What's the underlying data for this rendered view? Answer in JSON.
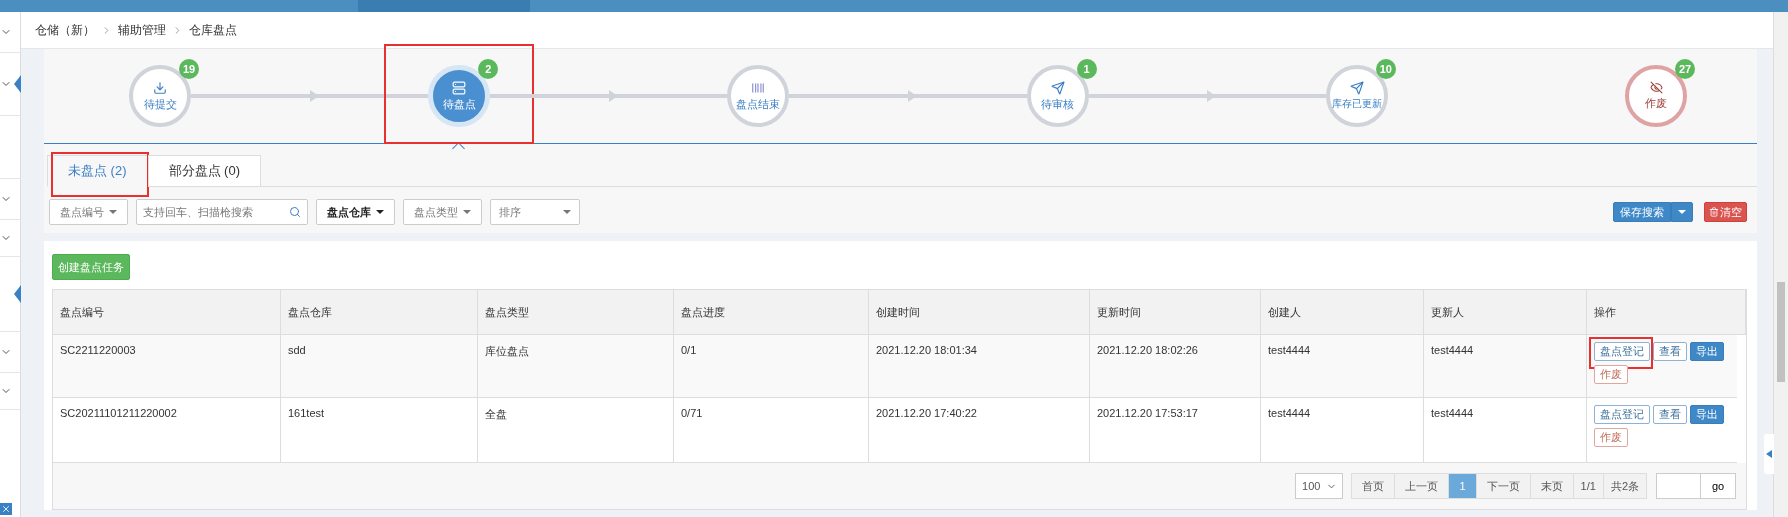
{
  "breadcrumb": [
    "仓储（新）",
    "辅助管理",
    "仓库盘点"
  ],
  "steps": [
    {
      "kind": "submit",
      "label": "待提交",
      "count": "19",
      "selected": false,
      "highlighted": false
    },
    {
      "kind": "counting",
      "label": "待盘点",
      "count": "2",
      "selected": true,
      "highlighted": true
    },
    {
      "kind": "finished",
      "label": "盘点结束",
      "selected": false,
      "highlighted": false
    },
    {
      "kind": "review",
      "label": "待审核",
      "count": "1",
      "selected": false,
      "highlighted": false
    },
    {
      "kind": "updated",
      "label": "库存已更新",
      "count": "10",
      "selected": false,
      "highlighted": false
    },
    {
      "kind": "void",
      "label": "作废",
      "count": "27",
      "selected": false,
      "highlighted": false
    }
  ],
  "tabs": [
    {
      "label": "未盘点 (2)",
      "selected": true,
      "highlighted": true
    },
    {
      "label": "部分盘点 (0)",
      "selected": false,
      "highlighted": false
    }
  ],
  "filters": [
    {
      "kind": "dropdown",
      "label": "盘点编号",
      "active": false
    },
    {
      "kind": "search",
      "placeholder": "支持回车、扫描枪搜索"
    },
    {
      "kind": "dropdown",
      "label": "盘点仓库",
      "active": true
    },
    {
      "kind": "dropdown",
      "label": "盘点类型",
      "active": false
    },
    {
      "kind": "select",
      "label": "排序"
    }
  ],
  "save_search": "保存搜索",
  "clear": "清空",
  "create_button": "创建盘点任务",
  "table": {
    "columns": [
      "盘点编号",
      "盘点仓库",
      "盘点类型",
      "盘点进度",
      "创建时间",
      "更新时间",
      "创建人",
      "更新人",
      "操作"
    ],
    "rows": [
      {
        "cells": [
          "SC2211220003",
          "sdd",
          "库位盘点",
          "0/1",
          "2021.12.20 18:01:34",
          "2021.12.20 18:02:26",
          "test4444",
          "test4444"
        ],
        "actions": [
          {
            "kind": "outline",
            "label": "盘点登记",
            "highlighted": true
          },
          {
            "kind": "outline",
            "label": "查看",
            "highlighted": false
          },
          {
            "kind": "primary",
            "label": "导出",
            "highlighted": false
          },
          {
            "kind": "danger",
            "label": "作废",
            "highlighted": false
          }
        ]
      },
      {
        "cells": [
          "SC20211101211220002",
          "161test",
          "全盘",
          "0/71",
          "2021.12.20 17:40:22",
          "2021.12.20 17:53:17",
          "test4444",
          "test4444"
        ],
        "actions": [
          {
            "kind": "outline",
            "label": "盘点登记",
            "highlighted": false
          },
          {
            "kind": "outline",
            "label": "查看",
            "highlighted": false
          },
          {
            "kind": "primary",
            "label": "导出",
            "highlighted": false
          },
          {
            "kind": "danger",
            "label": "作废",
            "highlighted": false
          }
        ]
      }
    ]
  },
  "pagination": {
    "page_size": "100",
    "pages": [
      {
        "label": "首页",
        "selected": false
      },
      {
        "label": "上一页",
        "selected": false
      },
      {
        "label": "1",
        "selected": true
      },
      {
        "label": "下一页",
        "selected": false
      },
      {
        "label": "末页",
        "selected": false
      }
    ],
    "page_info": "1/1",
    "total": "共2条",
    "go": "go"
  }
}
